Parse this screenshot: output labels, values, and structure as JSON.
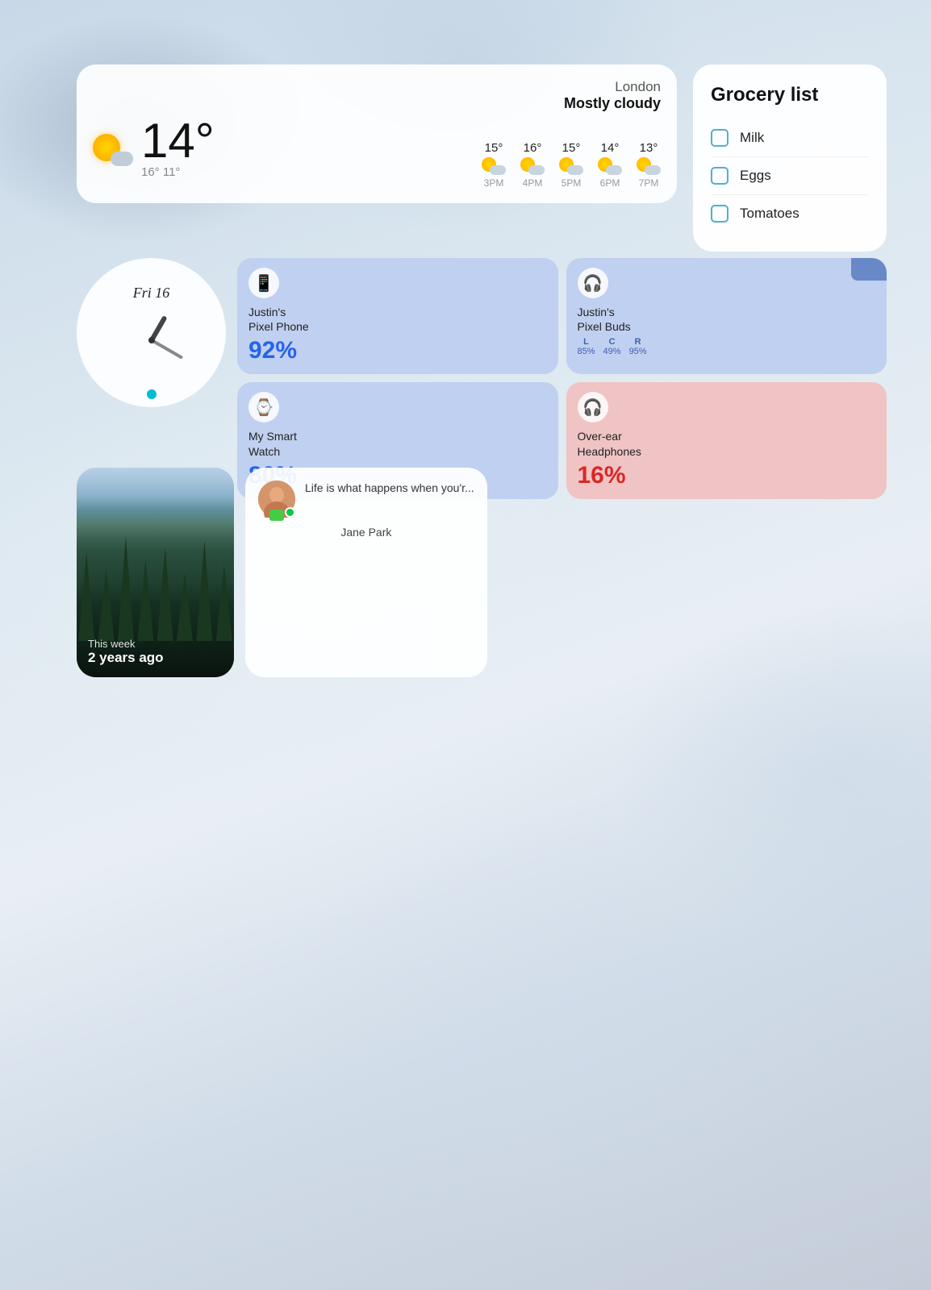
{
  "weather": {
    "city": "London",
    "condition": "Mostly cloudy",
    "temp": "14°",
    "range": "16° 11°",
    "forecast": [
      {
        "time": "3PM",
        "temp": "15°"
      },
      {
        "time": "4PM",
        "temp": "16°"
      },
      {
        "time": "5PM",
        "temp": "15°"
      },
      {
        "time": "6PM",
        "temp": "14°"
      },
      {
        "time": "7PM",
        "temp": "13°"
      }
    ]
  },
  "grocery": {
    "title": "Grocery list",
    "items": [
      "Milk",
      "Eggs",
      "Tomatoes"
    ]
  },
  "clock": {
    "date": "Fri 16"
  },
  "devices": [
    {
      "name": "Justin's\nPixel Phone",
      "battery": "92%",
      "type": "phone",
      "style": "blue"
    },
    {
      "name": "Justin's\nPixel Buds",
      "channels": [
        {
          "label": "L",
          "pct": "85%"
        },
        {
          "label": "C",
          "pct": "49%"
        },
        {
          "label": "R",
          "pct": "95%"
        }
      ],
      "type": "buds",
      "style": "blue"
    },
    {
      "name": "My Smart\nWatch",
      "battery": "80%",
      "type": "watch",
      "style": "blue"
    },
    {
      "name": "Over-ear\nHeadphones",
      "battery": "16%",
      "type": "headphones",
      "style": "pink"
    }
  ],
  "weather_small": {
    "temp_main": "14° London",
    "range": "16° 11°"
  },
  "contact": {
    "name": "Jane Park",
    "message": "Life is what happens when you'r...",
    "online": true
  },
  "photos": {
    "this_week": "This week",
    "years_ago": "2 years ago"
  }
}
